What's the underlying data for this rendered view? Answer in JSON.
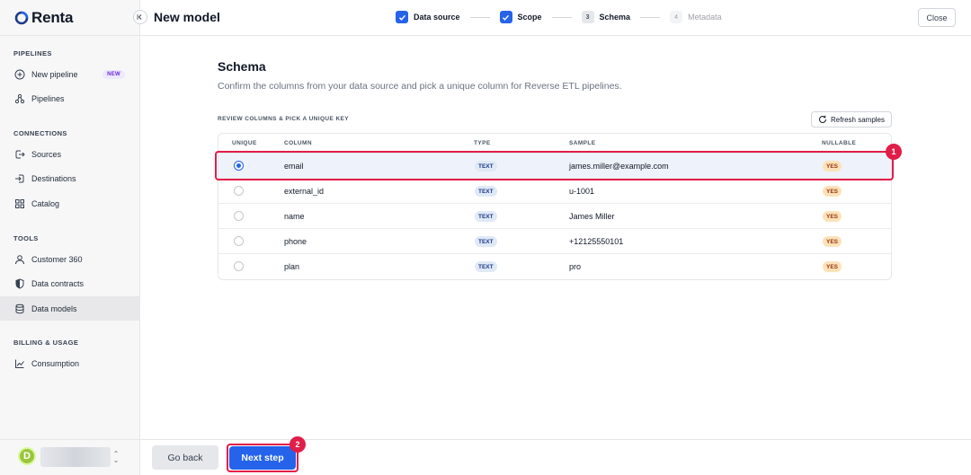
{
  "brand": {
    "logo_text": "Renta"
  },
  "header": {
    "title": "New model",
    "steps": [
      {
        "label": "Data source",
        "state": "done"
      },
      {
        "label": "Scope",
        "state": "done"
      },
      {
        "label": "Schema",
        "number": "3",
        "state": "current"
      },
      {
        "label": "Metadata",
        "number": "4",
        "state": "upcoming"
      }
    ],
    "close_label": "Close"
  },
  "sidebar": {
    "sections": [
      {
        "title": "PIPELINES"
      },
      {
        "title": "CONNECTIONS"
      },
      {
        "title": "TOOLS"
      },
      {
        "title": "BILLING & USAGE"
      }
    ],
    "items": [
      {
        "label": "New pipeline",
        "icon": "plus-circle-icon",
        "badge": "NEW"
      },
      {
        "label": "Pipelines",
        "icon": "pipelines-icon"
      },
      {
        "label": "Sources",
        "icon": "source-icon"
      },
      {
        "label": "Destinations",
        "icon": "destination-icon"
      },
      {
        "label": "Catalog",
        "icon": "catalog-icon"
      },
      {
        "label": "Customer 360",
        "icon": "user-icon"
      },
      {
        "label": "Data contracts",
        "icon": "shield-icon"
      },
      {
        "label": "Data models",
        "icon": "database-icon",
        "active": true
      },
      {
        "label": "Consumption",
        "icon": "chart-icon"
      }
    ],
    "account": {
      "avatar_letter": "D"
    }
  },
  "main": {
    "title": "Schema",
    "subtitle": "Confirm the columns from your data source and pick a unique column for Reverse ETL pipelines.",
    "review_label": "REVIEW COLUMNS & PICK A UNIQUE KEY",
    "refresh_label": "Refresh samples",
    "table": {
      "headers": [
        "UNIQUE",
        "COLUMN",
        "TYPE",
        "SAMPLE",
        "NULLABLE"
      ],
      "rows": [
        {
          "selected": true,
          "column": "email",
          "type": "TEXT",
          "sample": "james.miller@example.com",
          "nullable": "YES"
        },
        {
          "selected": false,
          "column": "external_id",
          "type": "TEXT",
          "sample": "u-1001",
          "nullable": "YES"
        },
        {
          "selected": false,
          "column": "name",
          "type": "TEXT",
          "sample": "James Miller",
          "nullable": "YES"
        },
        {
          "selected": false,
          "column": "phone",
          "type": "TEXT",
          "sample": "+12125550101",
          "nullable": "YES"
        },
        {
          "selected": false,
          "column": "plan",
          "type": "TEXT",
          "sample": "pro",
          "nullable": "YES"
        }
      ]
    }
  },
  "annotations": {
    "marker_1": "1",
    "marker_2": "2"
  },
  "footer": {
    "back_label": "Go back",
    "next_label": "Next step"
  },
  "colors": {
    "accent": "#2563eb",
    "highlight": "#e11d48",
    "yes_badge": "#fde2b8",
    "type_badge": "#e0e9f6"
  }
}
